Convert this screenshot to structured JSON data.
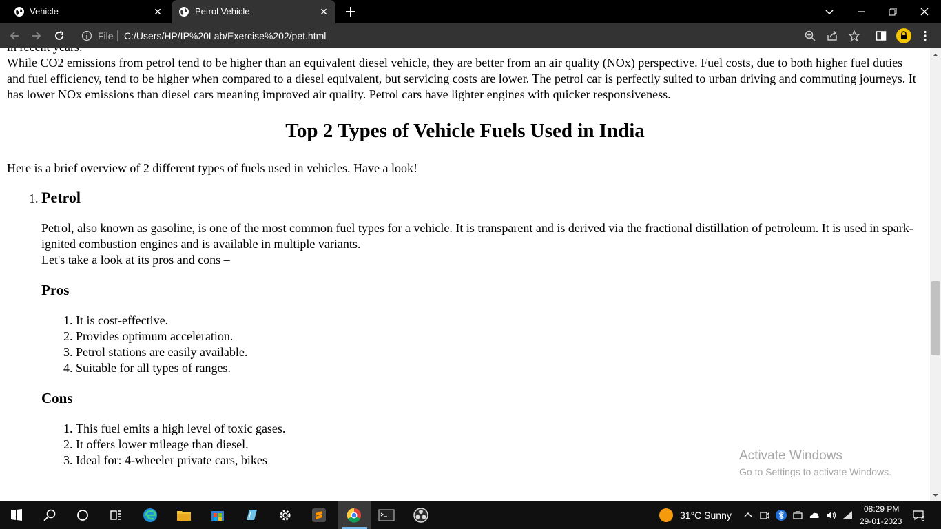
{
  "browser": {
    "tabs": [
      {
        "title": "Vehicle",
        "active": false
      },
      {
        "title": "Petrol Vehicle",
        "active": true
      }
    ],
    "address": {
      "scheme_label": "File",
      "url": "C:/Users/HP/IP%20Lab/Exercise%202/pet.html"
    }
  },
  "page": {
    "top_fragment": "in recent years.",
    "intro_paragraph": "While CO2 emissions from petrol tend to be higher than an equivalent diesel vehicle, they are better from an air quality (NOx) perspective. Fuel costs, due to both higher fuel duties and fuel efficiency, tend to be higher when compared to a diesel equivalent, but servicing costs are lower. The petrol car is perfectly suited to urban driving and commuting journeys. It has lower NOx emissions than diesel cars meaning improved air quality. Petrol cars have lighter engines with quicker responsiveness.",
    "heading": "Top 2 Types of Vehicle Fuels Used in India",
    "overview": "Here is a brief overview of 2 different types of fuels used in vehicles. Have a look!",
    "fuels": [
      {
        "name": "Petrol",
        "description": "Petrol, also known as gasoline, is one of the most common fuel types for a vehicle. It is transparent and is derived via the fractional distillation of petroleum. It is used in spark-ignited combustion engines and is available in multiple variants.",
        "lead": "Let's take a look at its pros and cons –",
        "pros_title": "Pros",
        "pros": [
          "It is cost-effective.",
          "Provides optimum acceleration.",
          "Petrol stations are easily available.",
          "Suitable for all types of ranges."
        ],
        "cons_title": "Cons",
        "cons": [
          "This fuel emits a high level of toxic gases.",
          "It offers lower mileage than diesel.",
          "Ideal for: 4-wheeler private cars, bikes"
        ]
      }
    ]
  },
  "watermark": {
    "line1": "Activate Windows",
    "line2": "Go to Settings to activate Windows."
  },
  "taskbar": {
    "weather": "31°C  Sunny",
    "time": "08:29 PM",
    "date": "29-01-2023",
    "notification_count": "6"
  },
  "colors": {
    "accent_chrome": "#333333",
    "tabstrip": "#000000",
    "taskbar": "#101010",
    "profile": "#f5c400"
  }
}
